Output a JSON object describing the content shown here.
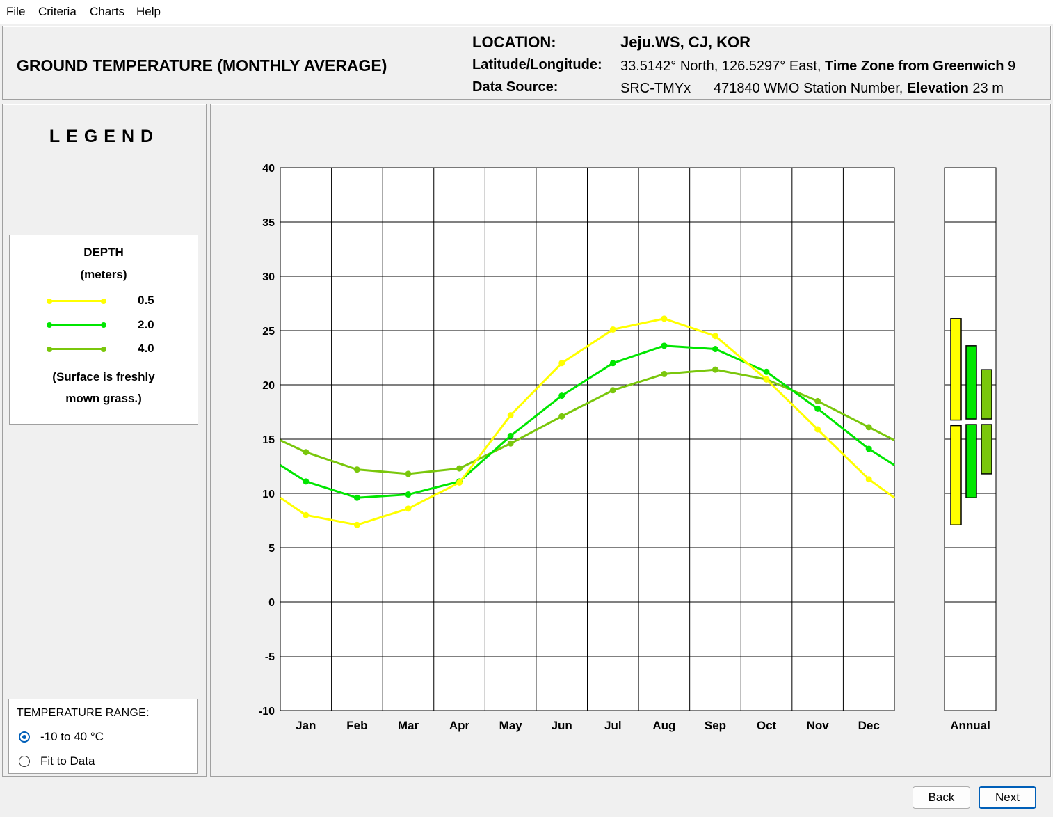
{
  "menu": [
    "File",
    "Criteria",
    "Charts",
    "Help"
  ],
  "header": {
    "title": "GROUND TEMPERATURE (MONTHLY AVERAGE)",
    "location_label": "LOCATION:",
    "location_value": "Jeju.WS, CJ, KOR",
    "latlon_label": "Latitude/Longitude:",
    "latlon_value": "33.5142° North, 126.5297° East,",
    "timezone_label": "Time Zone from Greenwich",
    "timezone_value": "9",
    "source_label": "Data Source:",
    "source_value": "SRC-TMYx",
    "station_value": "471840 WMO Station Number,",
    "elevation_label": "Elevation",
    "elevation_value": "23 m"
  },
  "legend": {
    "title": "LEGEND",
    "depth_title": "DEPTH",
    "depth_units": "(meters)",
    "entries": [
      {
        "label": "0.5",
        "color": "#ffff00"
      },
      {
        "label": "2.0",
        "color": "#00e600"
      },
      {
        "label": "4.0",
        "color": "#7ac70c"
      }
    ],
    "note_line1": "(Surface is freshly",
    "note_line2": "mown grass.)"
  },
  "temperature_range": {
    "title": "TEMPERATURE RANGE:",
    "options": [
      "-10 to 40 °C",
      "Fit to Data"
    ],
    "selected": 0
  },
  "buttons": {
    "back": "Back",
    "next": "Next"
  },
  "chart_data": {
    "type": "line",
    "categories": [
      "Jan",
      "Feb",
      "Mar",
      "Apr",
      "May",
      "Jun",
      "Jul",
      "Aug",
      "Sep",
      "Oct",
      "Nov",
      "Dec"
    ],
    "ylim": [
      -10,
      40
    ],
    "yticks": [
      40,
      35,
      30,
      25,
      20,
      15,
      10,
      5,
      0,
      -5,
      -10
    ],
    "grid": true,
    "series": [
      {
        "name": "0.5",
        "color": "#ffff00",
        "values": [
          8.0,
          7.1,
          8.6,
          11.0,
          17.2,
          22.0,
          25.1,
          26.1,
          24.5,
          20.5,
          15.9,
          11.3
        ],
        "edge_value": 9.6
      },
      {
        "name": "2.0",
        "color": "#00e600",
        "values": [
          11.1,
          9.6,
          9.9,
          11.1,
          15.3,
          19.0,
          22.0,
          23.6,
          23.3,
          21.2,
          17.8,
          14.1
        ],
        "edge_value": 12.6
      },
      {
        "name": "4.0",
        "color": "#7ac70c",
        "values": [
          13.8,
          12.2,
          11.8,
          12.3,
          14.6,
          17.1,
          19.5,
          21.0,
          21.4,
          20.5,
          18.5,
          16.1
        ],
        "edge_value": 14.9
      }
    ],
    "annual": {
      "label": "Annual",
      "bars": [
        {
          "color": "#ffff00",
          "min": 7.1,
          "max": 26.1,
          "mean": 16.5
        },
        {
          "color": "#00e600",
          "min": 9.6,
          "max": 23.6,
          "mean": 16.6
        },
        {
          "color": "#7ac70c",
          "min": 11.8,
          "max": 21.4,
          "mean": 16.6
        }
      ]
    }
  }
}
